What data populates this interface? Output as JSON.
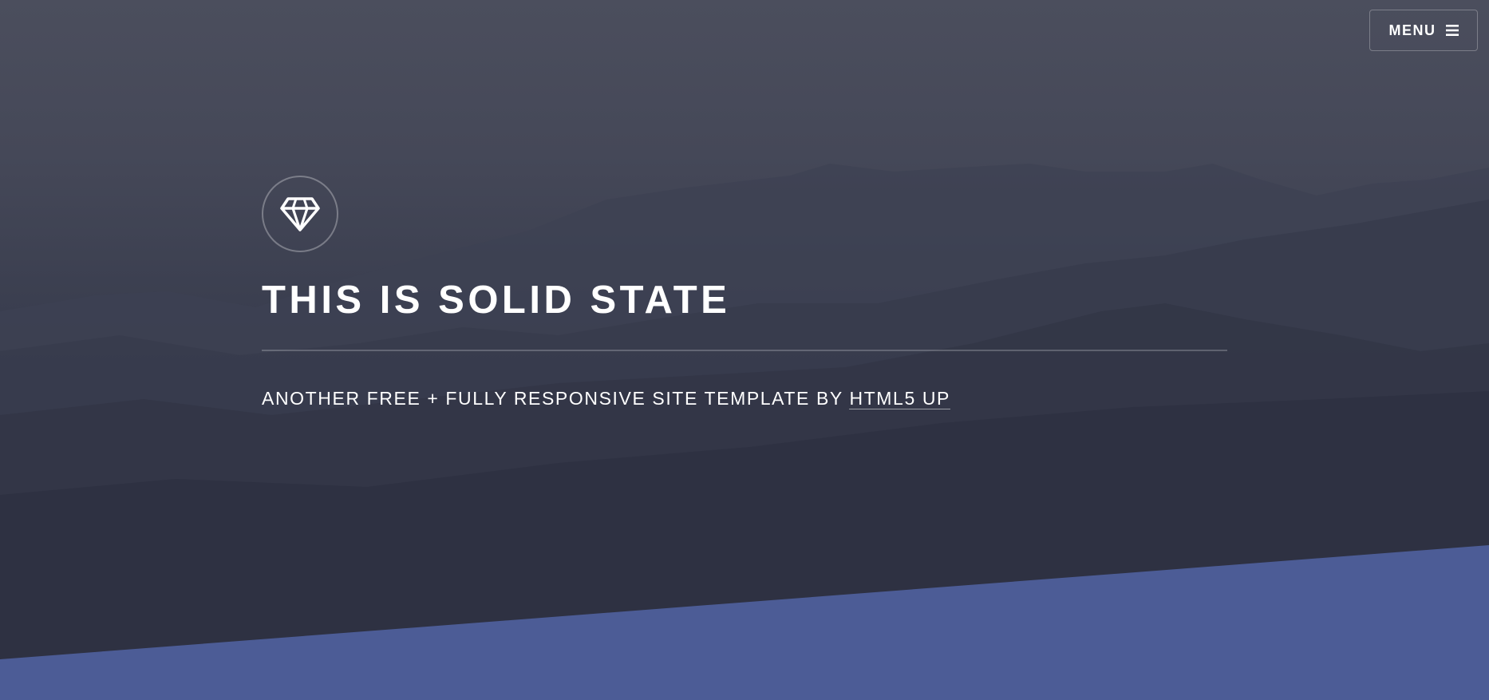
{
  "header": {
    "menu_label": "MENU",
    "menu_icon": "bars-icon"
  },
  "banner": {
    "logo_icon": "diamond-icon",
    "title": "THIS IS SOLID STATE",
    "subtitle_prefix": "ANOTHER FREE + FULLY RESPONSIVE SITE TEMPLATE BY ",
    "subtitle_link": "HTML5 UP"
  },
  "colors": {
    "background": "#2e3141",
    "accent": "#4c5c96",
    "text": "#ffffff"
  }
}
